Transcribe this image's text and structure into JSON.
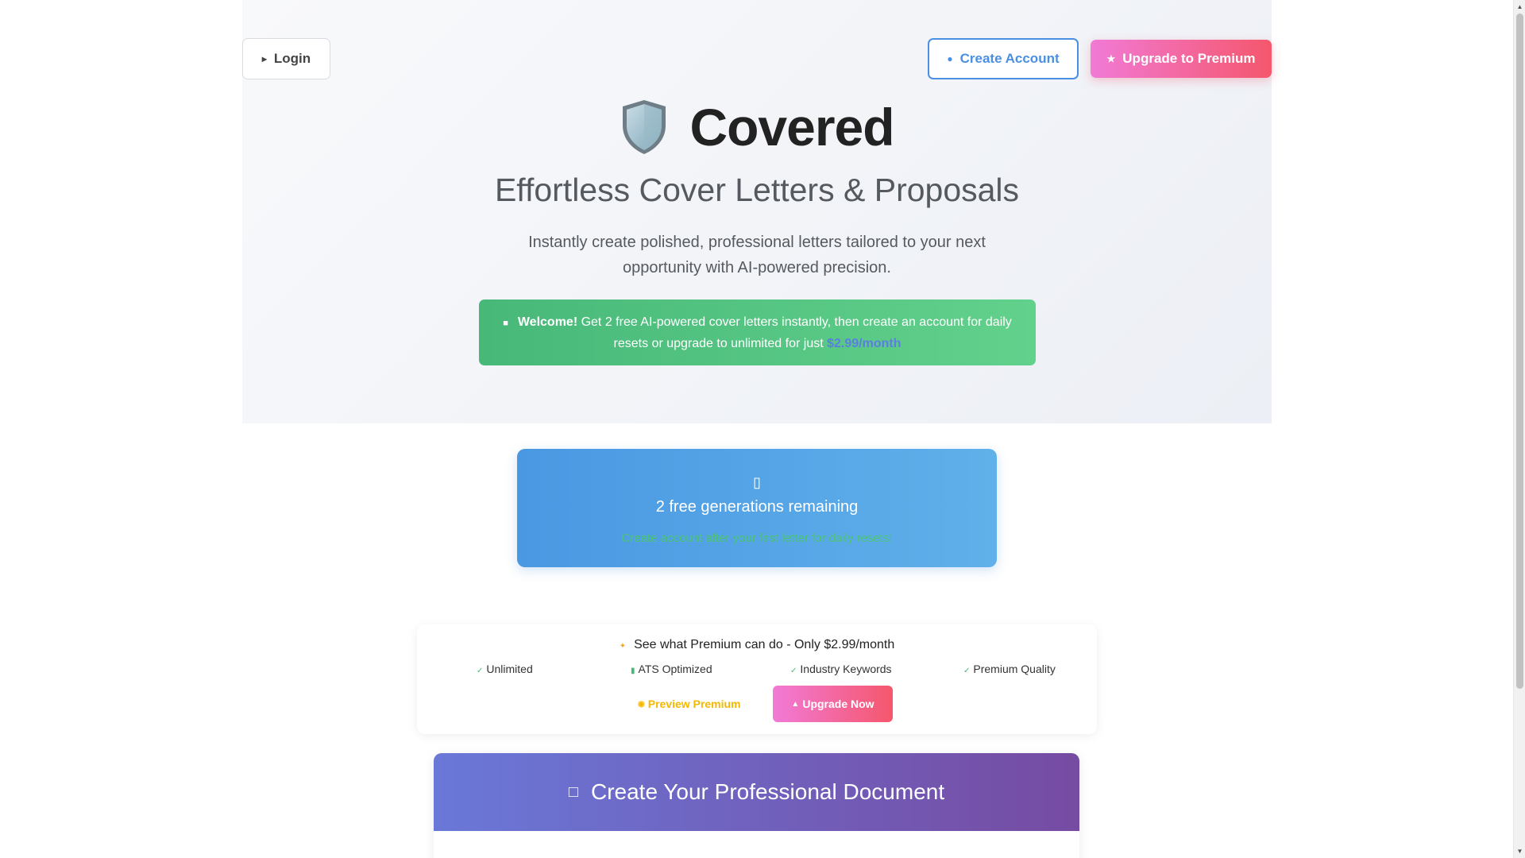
{
  "header": {
    "login_label": "Login",
    "create_account_label": "Create Account",
    "upgrade_label": "Upgrade to Premium"
  },
  "brand": {
    "name": "Covered",
    "logo_icon": "shield-icon",
    "subtitle": "Effortless Cover Letters & Proposals",
    "tagline": "Instantly create polished, professional letters tailored to your next opportunity with AI-powered precision."
  },
  "welcome": {
    "strong": "Welcome!",
    "text": " Get 2 free AI-powered cover letters instantly, then create an account for daily resets or upgrade to unlimited for just ",
    "price": "$2.99/month"
  },
  "free_generations": {
    "count_text": "2 free generations remaining",
    "note": "Create account after your first letter for daily resets!"
  },
  "premium": {
    "heading": "See what Premium can do - Only $2.99/month",
    "features": [
      "Unlimited",
      "ATS Optimized",
      "Industry Keywords",
      "Premium Quality"
    ],
    "preview_label": "Preview Premium",
    "upgrade_now_label": "Upgrade Now"
  },
  "document": {
    "title": "Create Your Professional Document"
  },
  "colors": {
    "accent_blue": "#4a90e2",
    "premium_pink": "#f5576c",
    "success_green": "#48b879",
    "doc_purple": "#764ba2"
  }
}
